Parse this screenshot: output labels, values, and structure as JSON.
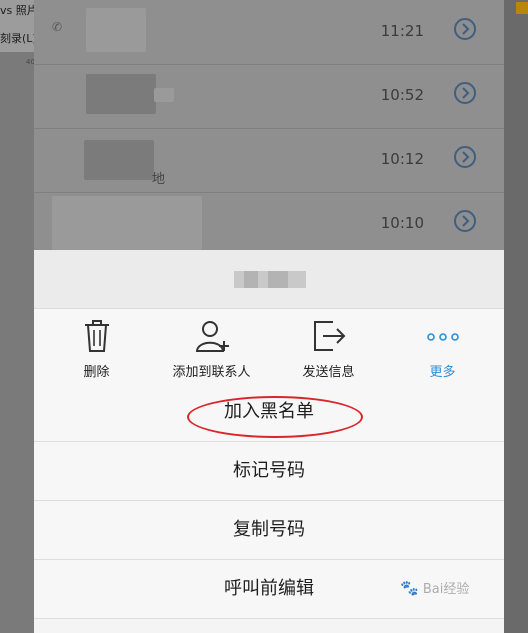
{
  "desktop": {
    "title_fragment": "vs 照片",
    "menu_fragment": "刻录(L)",
    "ruler_fragment": "40"
  },
  "call_list": {
    "rows": [
      {
        "time": "11:21"
      },
      {
        "time": "10:52"
      },
      {
        "time": "10:12",
        "sub_fragment": "地"
      },
      {
        "time": "10:10"
      }
    ]
  },
  "sheet": {
    "actions": [
      {
        "label": "删除",
        "icon": "trash-icon"
      },
      {
        "label": "添加到联系人",
        "icon": "add-contact-icon"
      },
      {
        "label": "发送信息",
        "icon": "send-icon"
      },
      {
        "label": "更多",
        "icon": "more-icon"
      }
    ],
    "menu": [
      {
        "label": "加入黑名单"
      },
      {
        "label": "标记号码"
      },
      {
        "label": "复制号码"
      },
      {
        "label": "呼叫前编辑"
      }
    ]
  },
  "watermark": {
    "text": "Bai经验"
  },
  "colors": {
    "accent": "#2a8fd6",
    "annotation": "#d9262b"
  }
}
